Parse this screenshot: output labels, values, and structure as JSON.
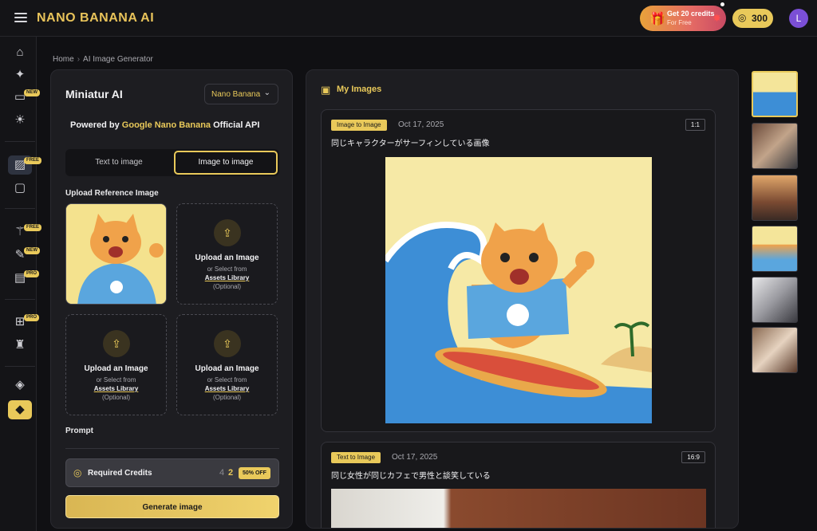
{
  "app": {
    "brand": "NANO BANANA AI",
    "promo_line1": "Get 20 credits",
    "promo_line2": "For Free",
    "credits": "300",
    "avatar_initial": "L"
  },
  "nav": {
    "badges": {
      "chat": "NEW",
      "image": "FREE",
      "magic": "FREE",
      "edit": "NEW",
      "video": "PRO",
      "gift": "PRO"
    }
  },
  "breadcrumb": {
    "home": "Home",
    "separator": "›",
    "current": "AI Image Generator"
  },
  "left": {
    "model_title": "Miniatur AI",
    "model_select": "Nano Banana",
    "powered_prefix": "Powered by ",
    "powered_brand": "Google Nano Banana",
    "powered_suffix": " Official API",
    "tabs": [
      "Text to image",
      "Image to image"
    ],
    "active_tab": 1,
    "upload_label": "Upload Reference Image",
    "upload_slot": {
      "title": "Upload an Image",
      "or_select": "or Select from",
      "library": "Assets Library",
      "optional": "(Optional)"
    },
    "prompt_label": "Prompt",
    "required_credits_label": "Required Credits",
    "credits_old": "4",
    "credits_new": "2",
    "discount": "50% OFF",
    "generate_label": "Generate image"
  },
  "main": {
    "title": "My Images",
    "cards": [
      {
        "mode": "Image to Image",
        "date": "Oct 17, 2025",
        "ratio": "1:1",
        "caption": "同じキャラクターがサーフィンしている画像"
      },
      {
        "mode": "Text to Image",
        "date": "Oct 17, 2025",
        "ratio": "16:9",
        "caption": "同じ女性が同じカフェで男性と談笑している"
      }
    ]
  },
  "colors": {
    "accent": "#e9c95a",
    "panel": "#1d1d21",
    "background": "#101013"
  },
  "icons": {
    "nav": [
      "home-icon",
      "sparkle-icon",
      "chat-icon",
      "bulb-icon",
      "image-icon",
      "video-camera-icon",
      "magic-wand-icon",
      "edit-icon",
      "film-icon",
      "gift-icon",
      "robot-icon",
      "layers-icon",
      "diamond-icon"
    ],
    "upload": "upload-cloud-icon",
    "credits": "coins-icon"
  }
}
